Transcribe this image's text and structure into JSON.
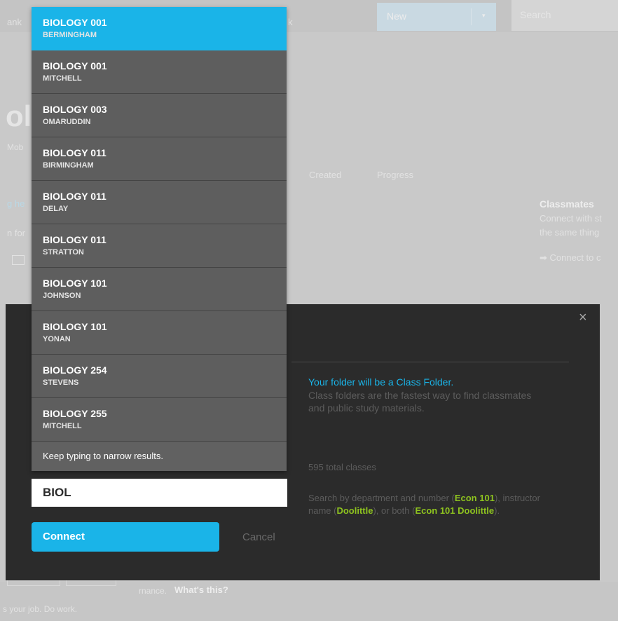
{
  "background": {
    "nav_left": "ank",
    "nav_mid": "k",
    "new_label": "New",
    "new_caret": "▾",
    "search_placeholder": "Search",
    "title_fragment": "ol",
    "subtitle": "Mob",
    "tab_created": "Created",
    "tab_progress": "Progress",
    "link_frag": "g he",
    "text_frag": "n for",
    "classmates_title": "Classmates",
    "classmates_line1": "Connect with st",
    "classmates_line2": "the same thing",
    "classmates_link": "➡ Connect to c",
    "bottom_mid": "rnance.",
    "bottom_whats_this": "What's this?",
    "bottom_left": "s your job. Do work."
  },
  "dropdown": {
    "items": [
      {
        "course": "BIOLOGY 001",
        "instructor": "BERMINGHAM"
      },
      {
        "course": "BIOLOGY 001",
        "instructor": "MITCHELL"
      },
      {
        "course": "BIOLOGY 003",
        "instructor": "OMARUDDIN"
      },
      {
        "course": "BIOLOGY 011",
        "instructor": "BIRMINGHAM"
      },
      {
        "course": "BIOLOGY 011",
        "instructor": "DELAY"
      },
      {
        "course": "BIOLOGY 011",
        "instructor": "STRATTON"
      },
      {
        "course": "BIOLOGY 101",
        "instructor": "JOHNSON"
      },
      {
        "course": "BIOLOGY 101",
        "instructor": "YONAN"
      },
      {
        "course": "BIOLOGY 254",
        "instructor": "STEVENS"
      },
      {
        "course": "BIOLOGY 255",
        "instructor": "MITCHELL"
      }
    ],
    "footer": "Keep typing to narrow results."
  },
  "modal": {
    "close_glyph": "×",
    "search_value": "BIOL",
    "connect_label": "Connect",
    "cancel_label": "Cancel",
    "info_title": "Your folder will be a Class Folder.",
    "info_body": "Class folders are the fastest way to find classmates and public study materials.",
    "total_classes": "595 total classes",
    "help": {
      "part1": "Search by department and number (",
      "ex1": "Econ 101",
      "part2": "), instructor name (",
      "ex2": "Doolittle",
      "part3": "), or both (",
      "ex3": "Econ 101 Doolittle",
      "part4": ")."
    }
  },
  "colors": {
    "accent": "#1ab4e8",
    "highlight": "#8ec31f",
    "modal_bg": "#2b2b2b",
    "dropdown_bg": "#5e5e5e"
  }
}
